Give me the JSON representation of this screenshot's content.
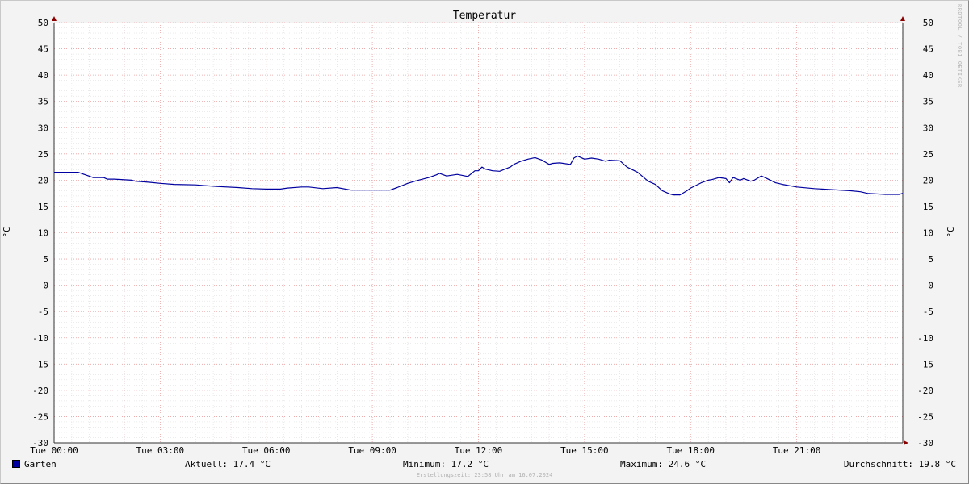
{
  "chart_data": {
    "type": "line",
    "title": "Temperatur",
    "ylabel_left": "°C",
    "ylabel_right": "°C",
    "ylim": [
      -30,
      50
    ],
    "y_ticks": [
      50,
      45,
      40,
      35,
      30,
      25,
      20,
      15,
      10,
      5,
      0,
      -5,
      -10,
      -15,
      -20,
      -25,
      -30
    ],
    "x_range_hours": [
      0,
      24
    ],
    "x_tick_labels": [
      {
        "hour": 0,
        "label": "Tue 00:00"
      },
      {
        "hour": 3,
        "label": "Tue 03:00"
      },
      {
        "hour": 6,
        "label": "Tue 06:00"
      },
      {
        "hour": 9,
        "label": "Tue 09:00"
      },
      {
        "hour": 12,
        "label": "Tue 12:00"
      },
      {
        "hour": 15,
        "label": "Tue 15:00"
      },
      {
        "hour": 18,
        "label": "Tue 18:00"
      },
      {
        "hour": 21,
        "label": "Tue 21:00"
      }
    ],
    "grid": true,
    "series": [
      {
        "name": "Garten",
        "color": "#0000a0",
        "x_hours": [
          0,
          0.3,
          0.6,
          0.68,
          0.9,
          1.1,
          1.4,
          1.5,
          1.7,
          2.2,
          2.3,
          2.7,
          3.0,
          3.4,
          4.0,
          4.6,
          5.2,
          5.6,
          6.0,
          6.4,
          6.6,
          7.0,
          7.2,
          7.6,
          8.0,
          8.4,
          9.0,
          9.5,
          9.7,
          10.0,
          10.3,
          10.6,
          10.8,
          10.9,
          11.1,
          11.4,
          11.7,
          11.9,
          12.0,
          12.1,
          12.2,
          12.4,
          12.6,
          12.9,
          13.0,
          13.2,
          13.4,
          13.6,
          13.8,
          14.0,
          14.1,
          14.3,
          14.6,
          14.7,
          14.8,
          15.0,
          15.2,
          15.4,
          15.6,
          15.7,
          16.0,
          16.2,
          16.5,
          16.8,
          17.0,
          17.2,
          17.4,
          17.5,
          17.7,
          17.9,
          18.0,
          18.3,
          18.5,
          18.6,
          18.8,
          19.0,
          19.1,
          19.2,
          19.4,
          19.5,
          19.7,
          19.8,
          20.0,
          20.1,
          20.4,
          20.6,
          21.0,
          21.5,
          22.0,
          22.5,
          22.8,
          23.0,
          23.5,
          23.9,
          24.0
        ],
        "y_values": [
          21.5,
          21.5,
          21.5,
          21.5,
          21.0,
          20.5,
          20.5,
          20.2,
          20.2,
          20.0,
          19.8,
          19.6,
          19.4,
          19.2,
          19.1,
          18.8,
          18.6,
          18.4,
          18.3,
          18.3,
          18.5,
          18.7,
          18.7,
          18.4,
          18.6,
          18.1,
          18.1,
          18.1,
          18.6,
          19.4,
          20.0,
          20.5,
          21.0,
          21.3,
          20.8,
          21.1,
          20.7,
          21.8,
          21.8,
          22.5,
          22.1,
          21.8,
          21.7,
          22.5,
          23.0,
          23.6,
          24.0,
          24.3,
          23.8,
          23.0,
          23.2,
          23.3,
          23.0,
          24.2,
          24.6,
          24.0,
          24.2,
          24.0,
          23.6,
          23.8,
          23.7,
          22.5,
          21.5,
          19.8,
          19.2,
          18.0,
          17.4,
          17.2,
          17.2,
          18.0,
          18.5,
          19.5,
          20.0,
          20.1,
          20.5,
          20.3,
          19.5,
          20.5,
          20.0,
          20.3,
          19.8,
          20.0,
          20.8,
          20.5,
          19.5,
          19.2,
          18.7,
          18.4,
          18.2,
          18.0,
          17.8,
          17.5,
          17.3,
          17.3,
          17.5
        ]
      }
    ]
  },
  "legend": {
    "series_name": "Garten",
    "current": "Aktuell: 17.4 °C",
    "minimum": "Minimum: 17.2 °C",
    "maximum": "Maximum: 24.6 °C",
    "average": "Durchschnitt: 19.8 °C"
  },
  "footnote": "Erstellungszeit: 23:58 Uhr am 16.07.2024",
  "watermark": "RRDTOOL / TOBI OETIKER"
}
